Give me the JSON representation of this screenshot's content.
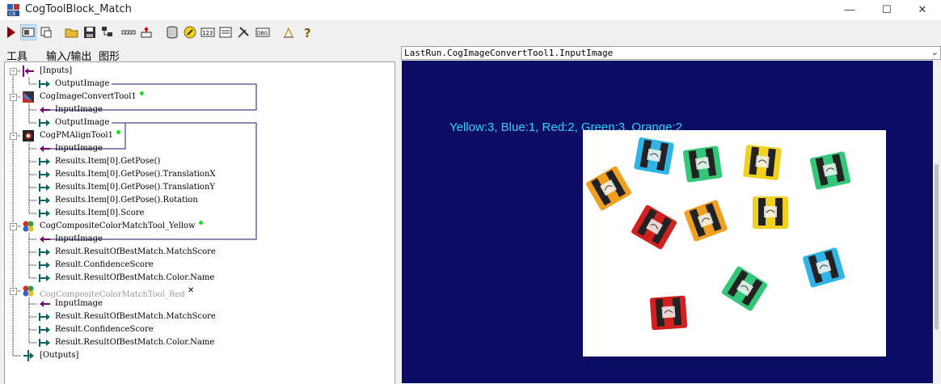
{
  "window": {
    "title": "CogToolBlock_Match"
  },
  "window_controls": {
    "minimize": "—",
    "maximize": "☐",
    "close": "✕"
  },
  "tabs": [
    "工具",
    "输入/输出",
    "图形"
  ],
  "tree": [
    {
      "label": "[Inputs]",
      "kind": "folder-in"
    },
    {
      "label": "OutputImage",
      "kind": "out"
    },
    {
      "label": "CogImageConvertTool1",
      "kind": "tool",
      "status": "ok"
    },
    {
      "label": "InputImage",
      "kind": "in"
    },
    {
      "label": "OutputImage",
      "kind": "out"
    },
    {
      "label": "CogPMAlignTool1",
      "kind": "tool",
      "status": "ok"
    },
    {
      "label": "InputImage",
      "kind": "in"
    },
    {
      "label": "Results.Item[0].GetPose()",
      "kind": "out"
    },
    {
      "label": "Results.Item[0].GetPose().TranslationX",
      "kind": "out"
    },
    {
      "label": "Results.Item[0].GetPose().TranslationY",
      "kind": "out"
    },
    {
      "label": "Results.Item[0].GetPose().Rotation",
      "kind": "out"
    },
    {
      "label": "Results.Item[0].Score",
      "kind": "out"
    },
    {
      "label": "CogCompositeColorMatchTool_Yellow",
      "kind": "tool",
      "status": "ok"
    },
    {
      "label": "InputImage",
      "kind": "in"
    },
    {
      "label": "Result.ResultOfBestMatch.MatchScore",
      "kind": "out"
    },
    {
      "label": "Result.ConfidenceScore",
      "kind": "out"
    },
    {
      "label": "Result.ResultOfBestMatch.Color.Name",
      "kind": "out"
    },
    {
      "label": "CogCompositeColorMatchTool_Red",
      "kind": "tool",
      "status": "disabled"
    },
    {
      "label": "InputImage",
      "kind": "in"
    },
    {
      "label": "Result.ResultOfBestMatch.MatchScore",
      "kind": "out"
    },
    {
      "label": "Result.ConfidenceScore",
      "kind": "out"
    },
    {
      "label": "Result.ResultOfBestMatch.Color.Name",
      "kind": "out"
    },
    {
      "label": "[Outputs]",
      "kind": "folder-out"
    }
  ],
  "display": {
    "record": "LastRun.CogImageConvertTool1.InputImage",
    "overlay_text": "Yellow:3,  Blue:1,  Red:2,  Green:3,  Orange:2"
  },
  "fuses": [
    {
      "color": "#f0a020"
    },
    {
      "color": "#30b4e8"
    },
    {
      "color": "#34c77a"
    },
    {
      "color": "#f0d020"
    },
    {
      "color": "#34c77a"
    },
    {
      "color": "#d02020"
    },
    {
      "color": "#f0a020"
    },
    {
      "color": "#f0d020"
    },
    {
      "color": "#30b4e8"
    },
    {
      "color": "#34c77a"
    },
    {
      "color": "#d02020"
    }
  ]
}
